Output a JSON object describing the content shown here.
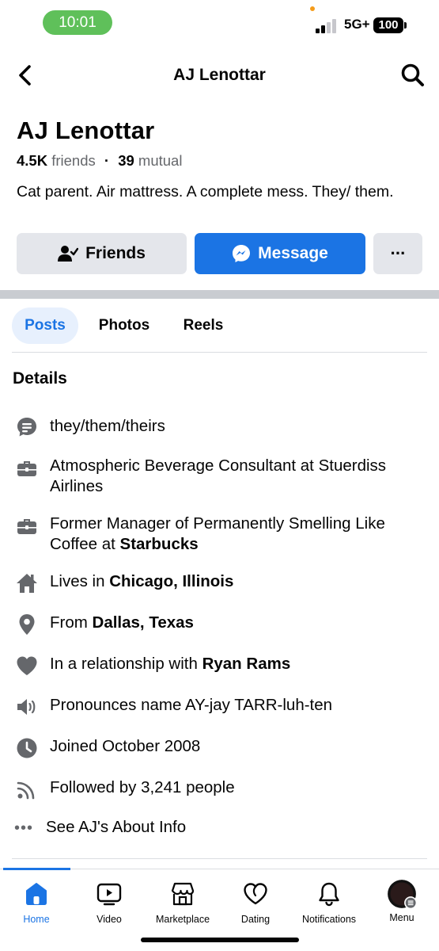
{
  "status_bar": {
    "time": "10:01",
    "network": "5G+",
    "battery": "100",
    "signal_bars_active": 2,
    "signal_bars_total": 4
  },
  "header": {
    "title": "AJ Lenottar",
    "back_icon": "chevron-left-icon",
    "search_icon": "search-icon"
  },
  "profile": {
    "name": "AJ Lenottar",
    "friends_count": "4.5K",
    "friends_label": "friends",
    "separator": "·",
    "mutual_count": "39",
    "mutual_label": "mutual",
    "bio": "Cat parent. Air mattress. A complete mess. They/ them."
  },
  "actions": {
    "friends_label": "Friends",
    "message_label": "Message",
    "more_label": "···"
  },
  "tabs": [
    {
      "label": "Posts",
      "active": true
    },
    {
      "label": "Photos",
      "active": false
    },
    {
      "label": "Reels",
      "active": false
    }
  ],
  "details": {
    "title": "Details",
    "items": [
      {
        "icon": "speech-bubble-icon",
        "text": "they/them/theirs"
      },
      {
        "icon": "briefcase-icon",
        "text": "Atmospheric Beverage Consultant at Stuerdiss Airlines"
      },
      {
        "icon": "briefcase-icon",
        "text_prefix": "Former Manager of Permanently Smelling Like Coffee at ",
        "text_bold": "Starbucks"
      },
      {
        "icon": "home-icon",
        "text_prefix": "Lives in ",
        "text_bold": "Chicago, Illinois"
      },
      {
        "icon": "location-pin-icon",
        "text_prefix": "From ",
        "text_bold": "Dallas, Texas"
      },
      {
        "icon": "heart-icon",
        "text_prefix": "In a relationship with ",
        "text_bold": "Ryan Rams"
      },
      {
        "icon": "speaker-icon",
        "text": "Pronounces name AY-jay TARR-luh-ten"
      },
      {
        "icon": "clock-icon",
        "text": "Joined October 2008"
      },
      {
        "icon": "rss-icon",
        "text": "Followed by 3,241 people"
      }
    ],
    "see_about": "See AJ's About Info"
  },
  "bottom_nav": [
    {
      "label": "Home",
      "icon": "home-icon",
      "active": true
    },
    {
      "label": "Video",
      "icon": "video-icon",
      "active": false
    },
    {
      "label": "Marketplace",
      "icon": "marketplace-icon",
      "active": false
    },
    {
      "label": "Dating",
      "icon": "dating-icon",
      "active": false
    },
    {
      "label": "Notifications",
      "icon": "bell-icon",
      "active": false
    },
    {
      "label": "Menu",
      "icon": "avatar-menu-icon",
      "active": false
    }
  ],
  "colors": {
    "accent": "#1b74e4",
    "button_gray": "#e4e6eb",
    "secondary_text": "#65676b",
    "time_pill": "#5fc05a"
  }
}
